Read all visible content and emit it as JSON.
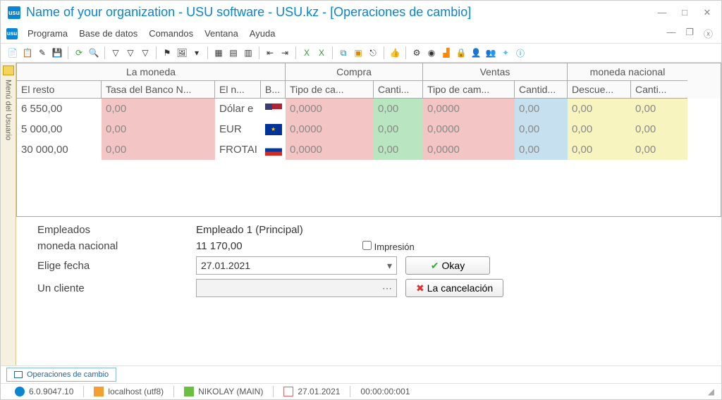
{
  "title": "Name of your organization - USU software - USU.kz - [Operaciones de cambio]",
  "menu": {
    "programa": "Programa",
    "basedatos": "Base de datos",
    "comandos": "Comandos",
    "ventana": "Ventana",
    "ayuda": "Ayuda"
  },
  "sidebar": {
    "label": "Menú del Usuario"
  },
  "grid": {
    "groups": {
      "moneda": "La moneda",
      "compra": "Compra",
      "ventas": "Ventas",
      "nacional": "moneda nacional"
    },
    "cols": {
      "resto": "El resto",
      "tasa": "Tasa del Banco N...",
      "nombre": "El n...",
      "bandera": "B...",
      "tipoc": "Tipo de ca...",
      "cantic": "Canti...",
      "tipov": "Tipo de cam...",
      "cantiv": "Cantid...",
      "desc": "Descue...",
      "cantin": "Canti..."
    },
    "rows": [
      {
        "resto": "6 550,00",
        "tasa": "0,00",
        "nombre": "Dólar e",
        "flag": "us",
        "tipoc": "0,0000",
        "cantic": "0,00",
        "tipov": "0,0000",
        "cantiv": "0,00",
        "desc": "0,00",
        "cantin": "0,00"
      },
      {
        "resto": "5 000,00",
        "tasa": "0,00",
        "nombre": "EUR",
        "flag": "eu",
        "tipoc": "0,0000",
        "cantic": "0,00",
        "tipov": "0,0000",
        "cantiv": "0,00",
        "desc": "0,00",
        "cantin": "0,00"
      },
      {
        "resto": "30 000,00",
        "tasa": "0,00",
        "nombre": "FROTAI",
        "flag": "ru",
        "tipoc": "0,0000",
        "cantic": "0,00",
        "tipov": "0,0000",
        "cantiv": "0,00",
        "desc": "0,00",
        "cantin": "0,00"
      }
    ]
  },
  "form": {
    "empleados_label": "Empleados",
    "empleados_value": "Empleado 1 (Principal)",
    "nacional_label": "moneda nacional",
    "nacional_value": "11 170,00",
    "fecha_label": "Elige fecha",
    "fecha_value": "27.01.2021",
    "cliente_label": "Un cliente",
    "cliente_value": "",
    "impresion_label": "Impresión",
    "ok_label": "Okay",
    "cancel_label": "La cancelación"
  },
  "tab": {
    "label": "Operaciones de cambio"
  },
  "status": {
    "version": "6.0.9047.10",
    "host": "localhost (utf8)",
    "user": "NIKOLAY (MAIN)",
    "date": "27.01.2021",
    "timer": "00:00:00:001"
  }
}
